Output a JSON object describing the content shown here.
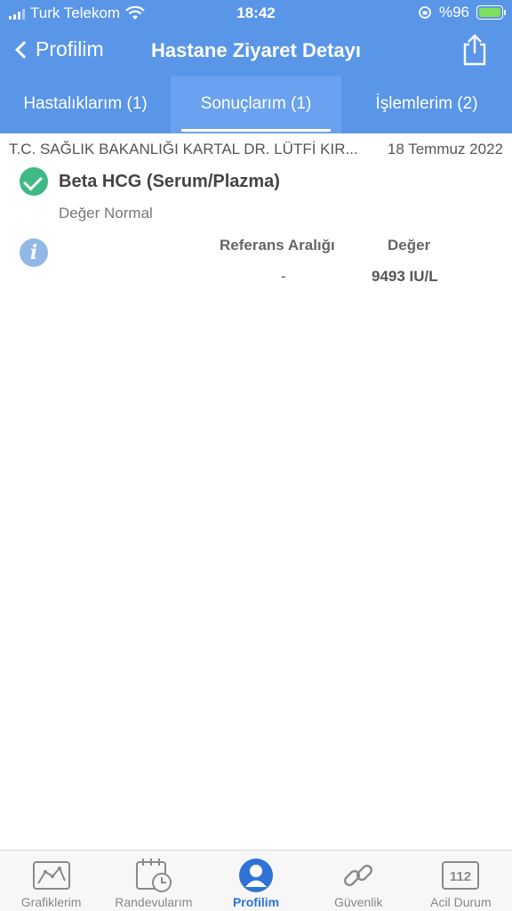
{
  "status_bar": {
    "carrier": "Turk Telekom",
    "time": "18:42",
    "battery": "%96"
  },
  "navbar": {
    "back_label": "Profilim",
    "title": "Hastane Ziyaret Detayı",
    "share_icon": "share-icon"
  },
  "tabs": [
    {
      "label": "Hastalıklarım (1)",
      "active": false
    },
    {
      "label": "Sonuçlarım (1)",
      "active": true
    },
    {
      "label": "İşlemlerim (2)",
      "active": false
    }
  ],
  "visit": {
    "hospital": "T.C. SAĞLIK BAKANLIĞI  KARTAL DR. LÜTFİ KIR...",
    "date": "18 Temmuz 2022"
  },
  "result": {
    "name": "Beta HCG (Serum/Plazma)",
    "status": "Değer Normal",
    "ref_header": "Referans Aralığı",
    "value_header": "Değer",
    "ref_value": "-",
    "value": "9493 IU/L"
  },
  "tabbar": [
    {
      "label": "Grafiklerim",
      "icon": "chart-icon",
      "active": false
    },
    {
      "label": "Randevularım",
      "icon": "calendar-icon",
      "active": false
    },
    {
      "label": "Profilim",
      "icon": "profile-icon",
      "active": true
    },
    {
      "label": "Güvenlik",
      "icon": "link-icon",
      "active": false
    },
    {
      "label": "Acil Durum",
      "icon": "emergency-112-icon",
      "active": false
    }
  ],
  "colors": {
    "header": "#5a96e8",
    "active_tab": "#2f73d6",
    "success": "#3fba85"
  },
  "emergency_number": "112"
}
